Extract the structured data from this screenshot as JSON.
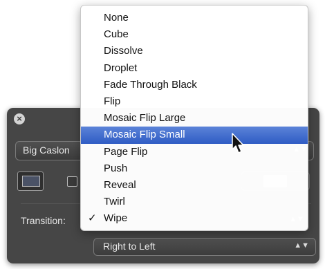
{
  "hud": {
    "close_icon": "close-icon",
    "font_popup_label": "Big Caslon",
    "transition_label": "Transition:",
    "direction_popup_label": "Right to Left"
  },
  "menu": {
    "items": [
      {
        "label": "None"
      },
      {
        "label": "Cube"
      },
      {
        "label": "Dissolve"
      },
      {
        "label": "Droplet"
      },
      {
        "label": "Fade Through Black"
      },
      {
        "label": "Flip"
      },
      {
        "label": "Mosaic Flip Large"
      },
      {
        "label": "Mosaic Flip Small",
        "highlighted": true
      },
      {
        "label": "Page Flip"
      },
      {
        "label": "Push"
      },
      {
        "label": "Reveal"
      },
      {
        "label": "Twirl"
      },
      {
        "label": "Wipe",
        "checked": true
      }
    ],
    "checkmark": "✓",
    "highlight_color": "#3a66cc"
  },
  "icons": {
    "popup_arrows": "⇕",
    "pointer": "arrow-pointer-icon"
  }
}
